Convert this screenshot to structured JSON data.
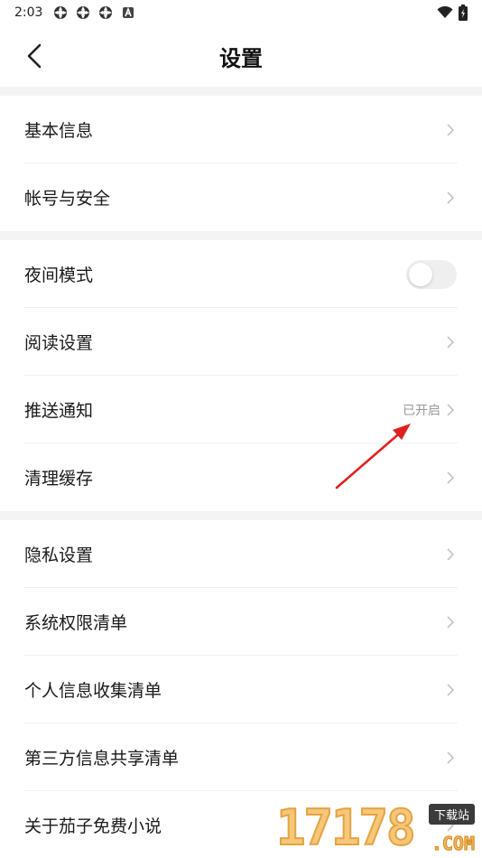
{
  "status_bar": {
    "time": "2:03",
    "notification_icons": [
      "app-icon",
      "app-icon",
      "app-icon",
      "a-icon"
    ],
    "right_icons": [
      "wifi-icon",
      "battery-icon"
    ]
  },
  "header": {
    "title": "设置"
  },
  "groups": [
    {
      "items": [
        {
          "label": "基本信息",
          "type": "link"
        },
        {
          "label": "帐号与安全",
          "type": "link"
        }
      ]
    },
    {
      "items": [
        {
          "label": "夜间模式",
          "type": "toggle",
          "on": false
        },
        {
          "label": "阅读设置",
          "type": "link"
        },
        {
          "label": "推送通知",
          "type": "link",
          "value": "已开启"
        },
        {
          "label": "清理缓存",
          "type": "link"
        }
      ]
    },
    {
      "items": [
        {
          "label": "隐私设置",
          "type": "link"
        },
        {
          "label": "系统权限清单",
          "type": "link"
        },
        {
          "label": "个人信息收集清单",
          "type": "link"
        },
        {
          "label": "第三方信息共享清单",
          "type": "link"
        },
        {
          "label": "关于茄子免费小说",
          "type": "link"
        }
      ]
    }
  ],
  "annotation": {
    "color": "#e02020"
  },
  "watermark": {
    "digits": "17178",
    "tag": "下载站",
    "suffix": ".COM"
  }
}
